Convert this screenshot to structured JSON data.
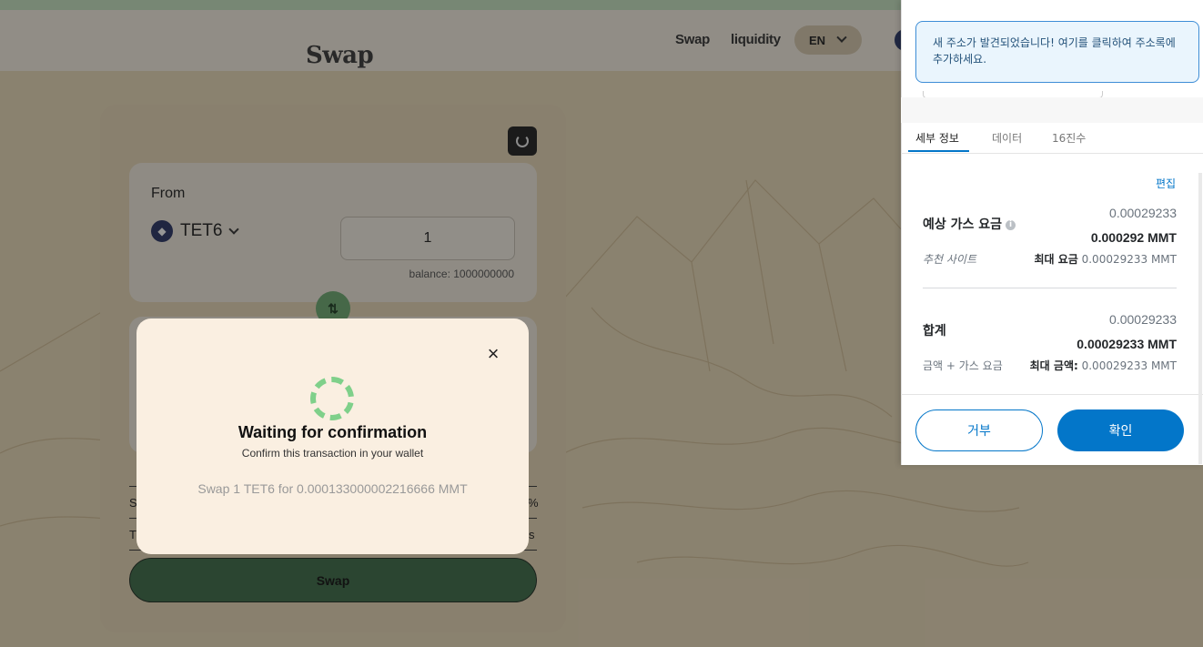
{
  "nav": {
    "swap": "Swap",
    "liquidity": "liquidity",
    "lang": "EN"
  },
  "logo": "Swap",
  "swap_card": {
    "from_label": "From",
    "token": "TET6",
    "amount": "1",
    "balance": "balance: 1000000000",
    "switch_icon": "⇅",
    "row1_left": "S",
    "row1_right": "%",
    "row2_left": "T",
    "row2_right": "s",
    "swap_button": "Swap"
  },
  "modal": {
    "title": "Waiting for confirmation",
    "subtitle": "Confirm this transaction in your wallet",
    "detail": "Swap 1 TET6 for 0.000133000002216666 MMT",
    "close": "×"
  },
  "metamask": {
    "notice": "새 주소가 발견되었습니다! 여기를 클릭하여 주소록에 추가하세요.",
    "tabs": [
      "세부 정보",
      "데이터",
      "16진수"
    ],
    "edit": "편집",
    "gas_label": "예상 가스 요금",
    "gas_value": "0.00029233",
    "gas_value_bold": "0.000292 MMT",
    "gas_site": "추천 사이트",
    "gas_max_label": "최대 요금",
    "gas_max_value": "0.00029233 MMT",
    "total_label": "합계",
    "total_value": "0.00029233",
    "total_value_bold": "0.00029233 MMT",
    "total_sub": "금액 + 가스 요금",
    "total_max_label": "최대 금액:",
    "total_max_value": "0.00029233 MMT",
    "reject": "거부",
    "confirm": "확인"
  },
  "colors": {
    "accent_green": "#3e6e4a",
    "metamask_blue": "#0376c9",
    "card_bg": "#e9d9b8"
  }
}
